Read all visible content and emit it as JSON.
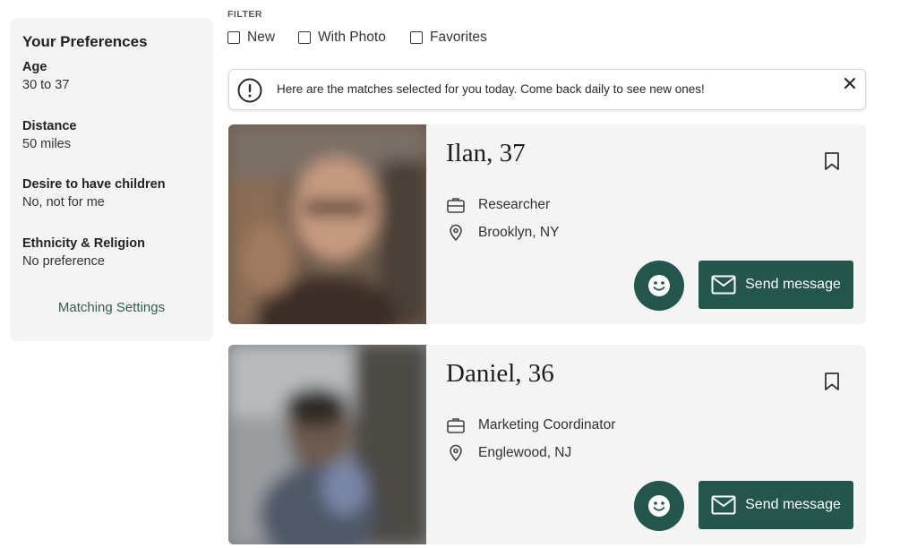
{
  "preferences": {
    "title": "Your Preferences",
    "items": [
      {
        "label": "Age",
        "value": "30 to 37"
      },
      {
        "label": "Distance",
        "value": "50 miles"
      },
      {
        "label": "Desire to have children",
        "value": "No, not for me"
      },
      {
        "label": "Ethnicity & Religion",
        "value": "No preference"
      }
    ],
    "link": "Matching Settings"
  },
  "filter": {
    "label": "FILTER",
    "options": [
      "New",
      "With Photo",
      "Favorites"
    ]
  },
  "notice": {
    "message": "Here are the matches selected for you today. Come back daily to see new ones!",
    "icon": "alert-circle-icon"
  },
  "matches": [
    {
      "name": "Ilan, 37",
      "occupation": "Researcher",
      "location": "Brooklyn, NY",
      "send_label": "Send message"
    },
    {
      "name": "Daniel, 36",
      "occupation": "Marketing Coordinator",
      "location": "Englewood, NJ",
      "send_label": "Send message"
    }
  ],
  "colors": {
    "accent": "#23564d",
    "card_bg": "#f4f4f4",
    "link": "#2f5e55"
  }
}
